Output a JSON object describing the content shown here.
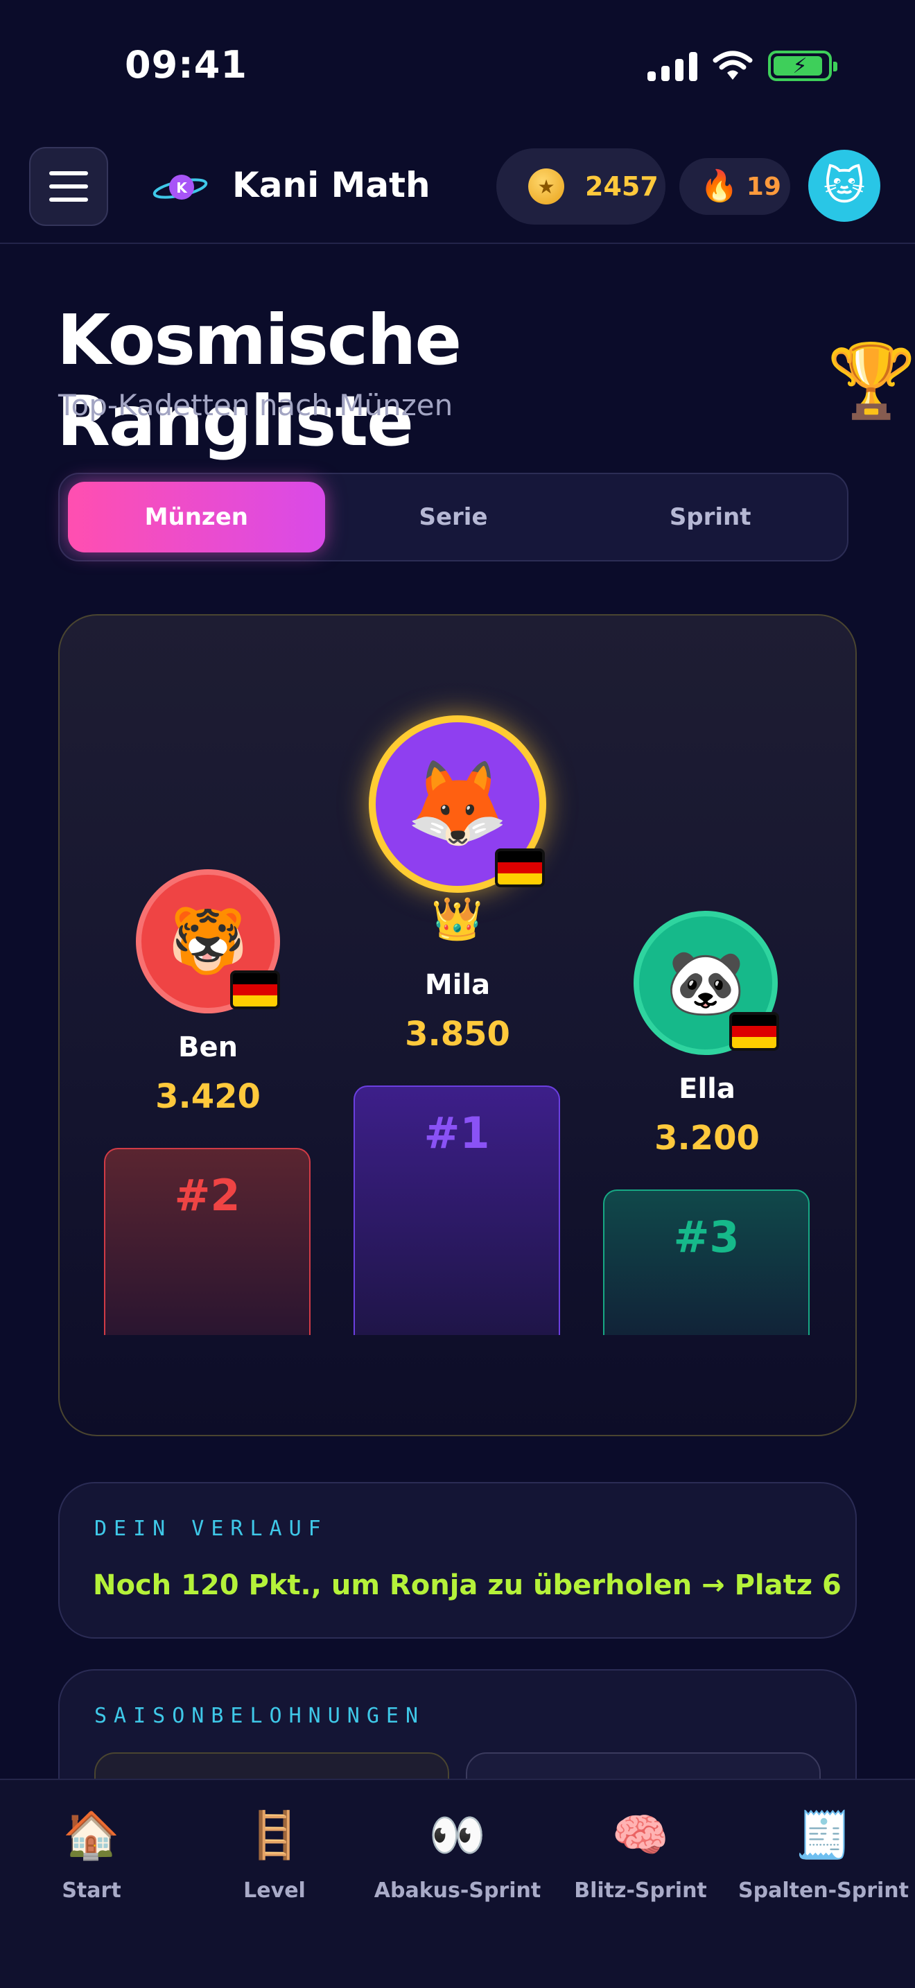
{
  "status_bar": {
    "time": "09:41"
  },
  "header": {
    "app_title": "Kani Math",
    "logo_letter": "K",
    "coins": "2457",
    "streak": "19",
    "avatar_icon": "cat-face-icon"
  },
  "page": {
    "title": "Kosmische Rangliste",
    "title_icon": "trophy-icon",
    "subtitle": "Top-Kadetten nach Münzen"
  },
  "tabs": [
    {
      "label": "Münzen",
      "active": true
    },
    {
      "label": "Serie",
      "active": false
    },
    {
      "label": "Sprint",
      "active": false
    }
  ],
  "podium": {
    "first": {
      "name": "Mila",
      "score": "3.850",
      "rank": "#1",
      "avatar": "fox-icon",
      "avatar_color": "#8f3ff0",
      "flag": "germany-flag-icon",
      "badge": "crown-icon"
    },
    "second": {
      "name": "Ben",
      "score": "3.420",
      "rank": "#2",
      "avatar": "tiger-icon",
      "avatar_color": "#ef4444",
      "flag": "germany-flag-icon"
    },
    "third": {
      "name": "Ella",
      "score": "3.200",
      "rank": "#3",
      "avatar": "panda-icon",
      "avatar_color": "#16b98a",
      "flag": "germany-flag-icon"
    }
  },
  "progress": {
    "label": "DEIN VERLAUF",
    "text": "Noch 120 Pkt., um Ronja zu überholen → Platz 6"
  },
  "rewards": {
    "label": "SAISONBELOHNUNGEN"
  },
  "bottom_nav": [
    {
      "label": "Start",
      "icon": "house-icon"
    },
    {
      "label": "Level",
      "icon": "ladder-icon"
    },
    {
      "label": "Abakus-Sprint",
      "icon": "eyes-icon"
    },
    {
      "label": "Blitz-Sprint",
      "icon": "brain-icon"
    },
    {
      "label": "Spalten-Sprint",
      "icon": "receipt-icon"
    }
  ],
  "colors": {
    "background": "#0b0c2a",
    "accent_pink": "#ff4fb0",
    "gold": "#ffc93c",
    "lime": "#b5f23a",
    "cyan": "#3fc8e8"
  }
}
